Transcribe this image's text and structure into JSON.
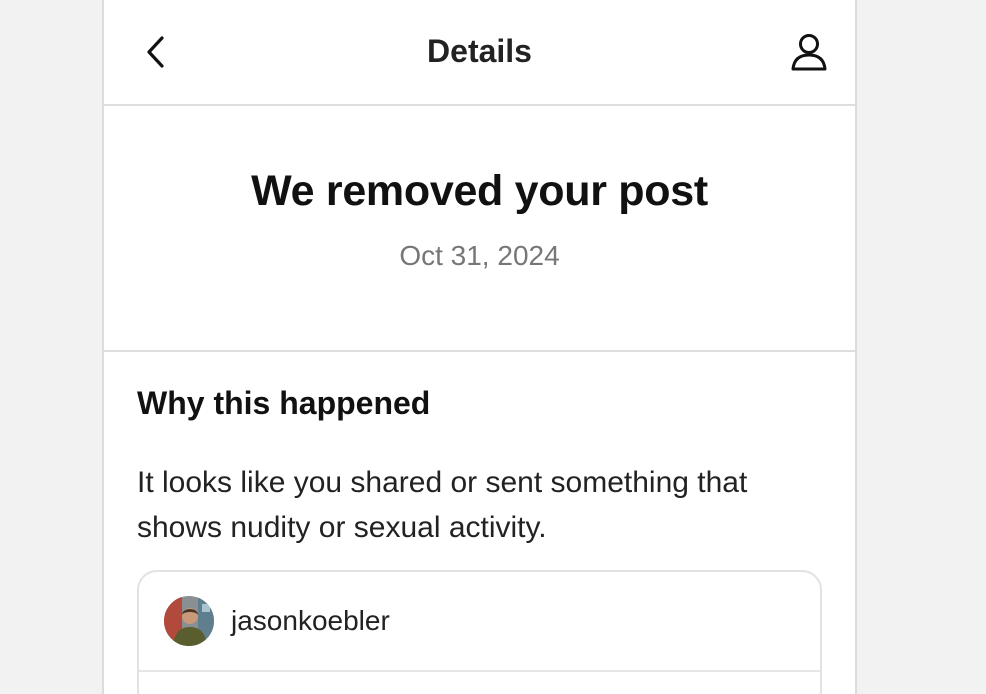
{
  "header": {
    "title": "Details",
    "back_icon": "chevron-left-icon",
    "profile_icon": "person-icon"
  },
  "notice": {
    "title": "We removed your post",
    "date": "Oct 31, 2024"
  },
  "reason": {
    "heading": "Why this happened",
    "body": "It looks like you shared or sent something that shows nudity or sexual activity."
  },
  "post": {
    "username": "jasonkoebler",
    "avatar_icon": "user-avatar"
  },
  "colors": {
    "page_background": "#f2f2f2",
    "panel_background": "#ffffff",
    "divider": "#dedede",
    "muted_text": "#777777",
    "primary_text": "#111111"
  }
}
